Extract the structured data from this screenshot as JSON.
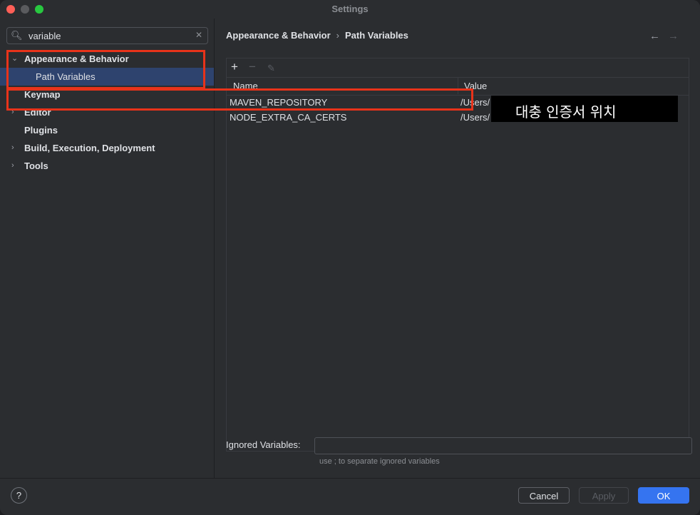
{
  "window": {
    "title": "Settings"
  },
  "sidebar": {
    "search_value": "variable",
    "tree": [
      {
        "label": "Appearance & Behavior",
        "expanded": true
      },
      {
        "label": "Path Variables",
        "selected": true
      },
      {
        "label": "Keymap"
      },
      {
        "label": "Editor",
        "collapsed": true
      },
      {
        "label": "Plugins"
      },
      {
        "label": "Build, Execution, Deployment",
        "collapsed": true
      },
      {
        "label": "Tools",
        "collapsed": true
      }
    ]
  },
  "breadcrumb": {
    "parent": "Appearance & Behavior",
    "current": "Path Variables"
  },
  "table": {
    "columns": {
      "name": "Name",
      "value": "Value"
    },
    "rows": [
      {
        "name": "MAVEN_REPOSITORY",
        "value": "/Users/"
      },
      {
        "name": "NODE_EXTRA_CA_CERTS",
        "value": "/Users/"
      }
    ]
  },
  "annotation": {
    "overlay_text": "대충 인증서 위치",
    "highlight_color": "#e8331a"
  },
  "ignored": {
    "label": "Ignored Variables:",
    "value": "",
    "hint": "use ; to separate ignored variables"
  },
  "footer": {
    "help": "?",
    "cancel": "Cancel",
    "apply": "Apply",
    "ok": "OK"
  },
  "colors": {
    "accent": "#3574f0",
    "selection": "#2e436e",
    "background": "#2b2d30"
  }
}
